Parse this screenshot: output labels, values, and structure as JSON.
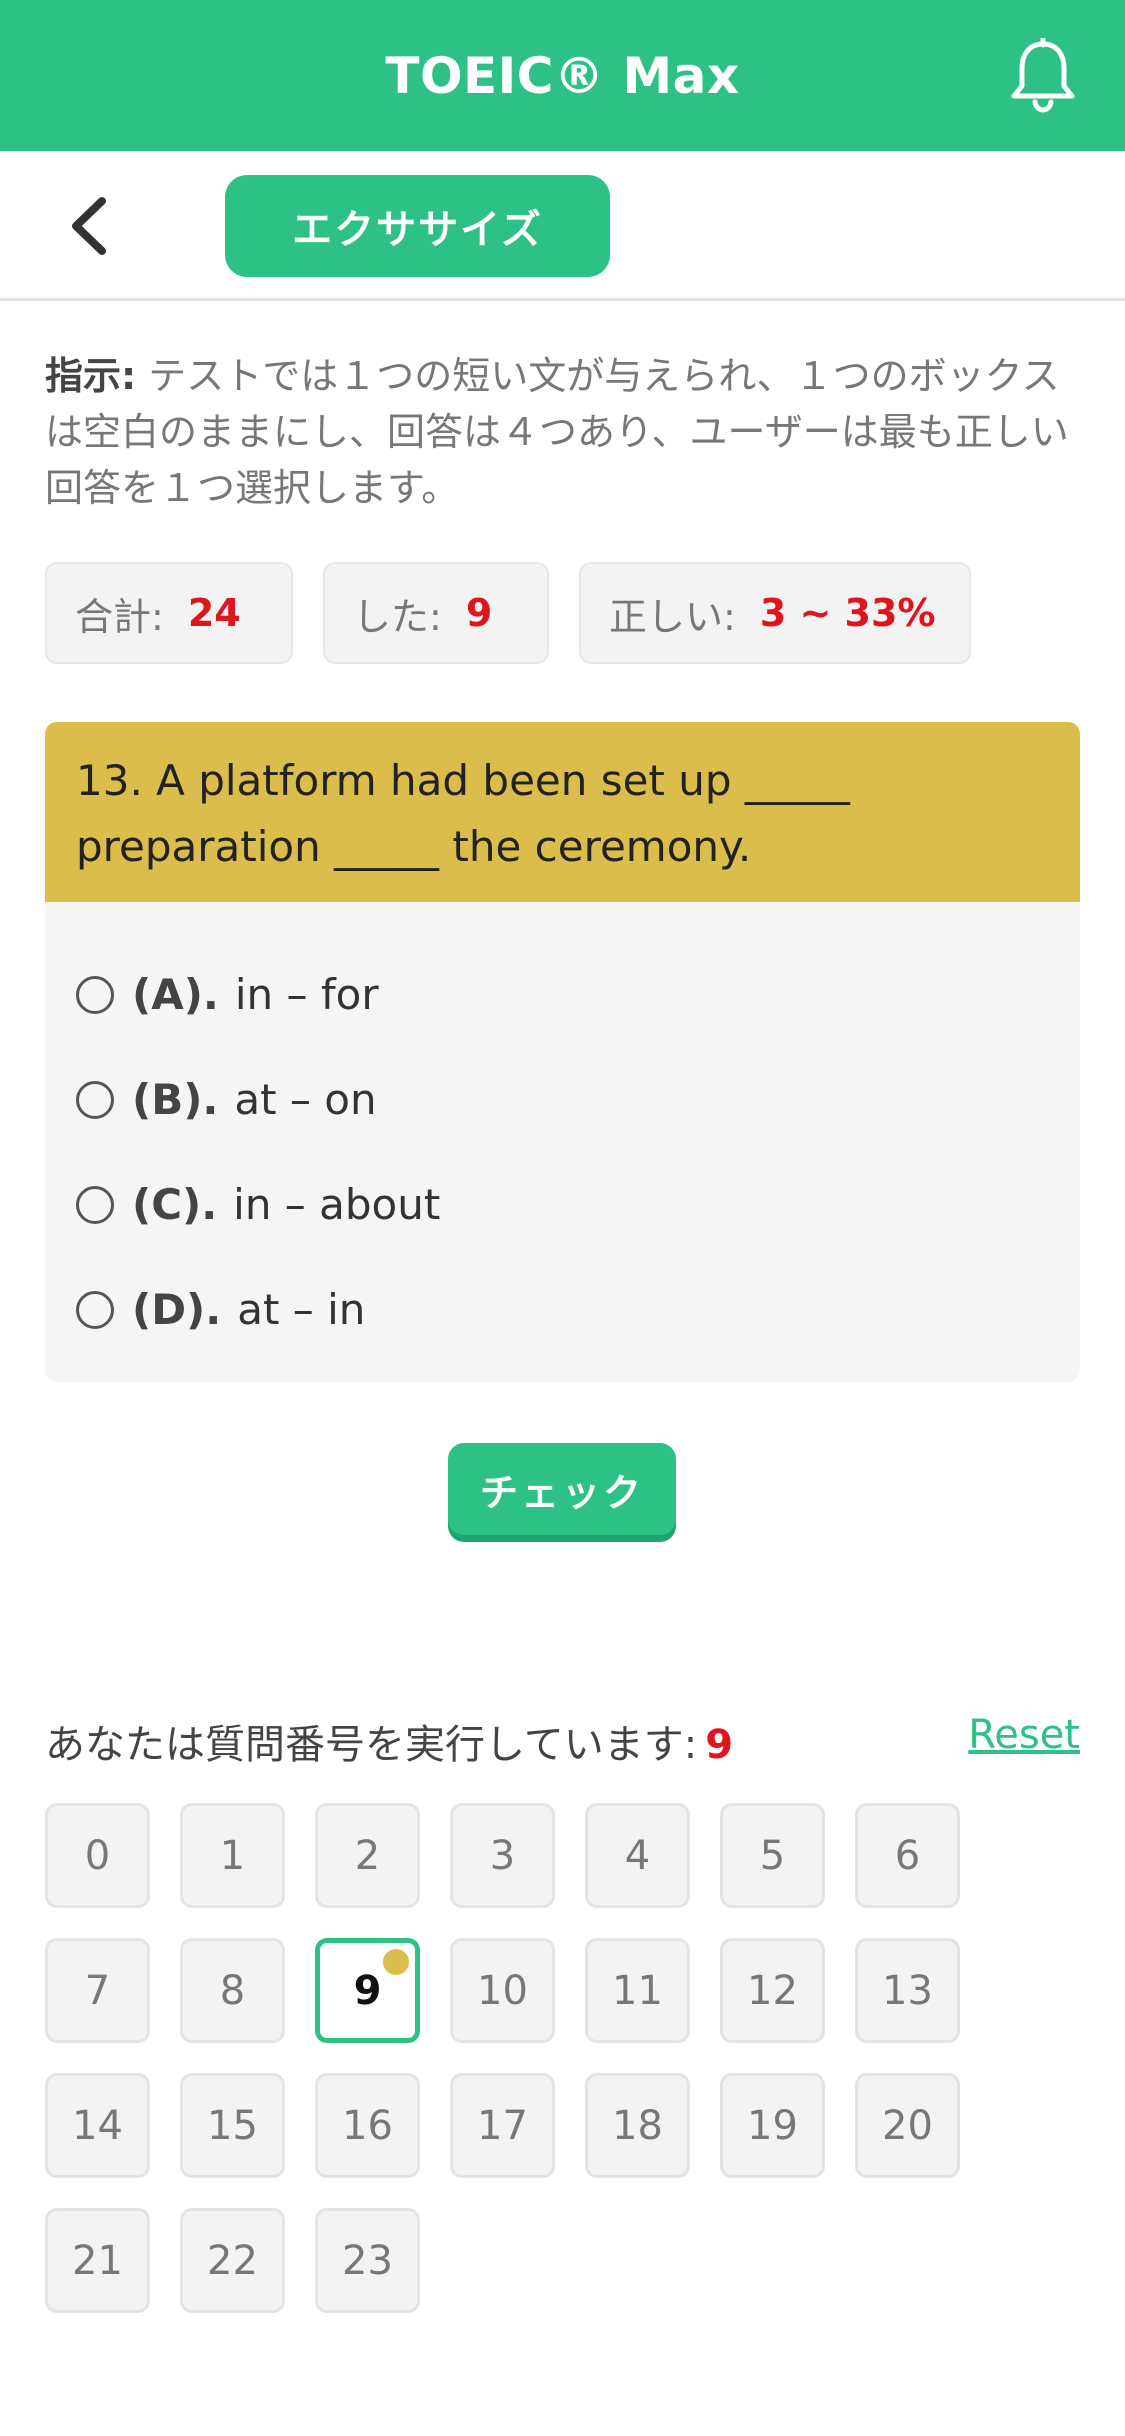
{
  "app": {
    "title": "TOEIC® Max"
  },
  "subheader": {
    "exercise_label": "エクササイズ"
  },
  "instructions": {
    "label": "指示:",
    "text": " テストでは１つの短い文が与えられ、１つのボックスは空白のままにし、回答は４つあり、ユーザーは最も正しい回答を１つ選択します。"
  },
  "stats": {
    "total_label": "合計:",
    "total_value": "24",
    "done_label": "した:",
    "done_value": "9",
    "correct_label": "正しい:",
    "correct_value": "3 ~ 33%"
  },
  "question": {
    "text": "13. A platform had been set up _____ preparation _____ the ceremony.",
    "options": [
      {
        "label": "(A).",
        "text": "in – for"
      },
      {
        "label": "(B).",
        "text": "at – on"
      },
      {
        "label": "(C).",
        "text": "in – about"
      },
      {
        "label": "(D).",
        "text": "at – in"
      }
    ]
  },
  "check_label": "チェック",
  "progress": {
    "text": "あなたは質問番号を実行しています:",
    "current": "9",
    "reset_label": "Reset"
  },
  "question_numbers": [
    "0",
    "1",
    "2",
    "3",
    "4",
    "5",
    "6",
    "7",
    "8",
    "9",
    "10",
    "11",
    "12",
    "13",
    "14",
    "15",
    "16",
    "17",
    "18",
    "19",
    "20",
    "21",
    "22",
    "23"
  ],
  "active_question": "9",
  "colors": {
    "primary": "#2ec185",
    "question_header": "#dbbd4c",
    "highlight": "#e0141d"
  },
  "icons": {
    "bell": "bell-icon",
    "back": "chevron-left-icon"
  }
}
